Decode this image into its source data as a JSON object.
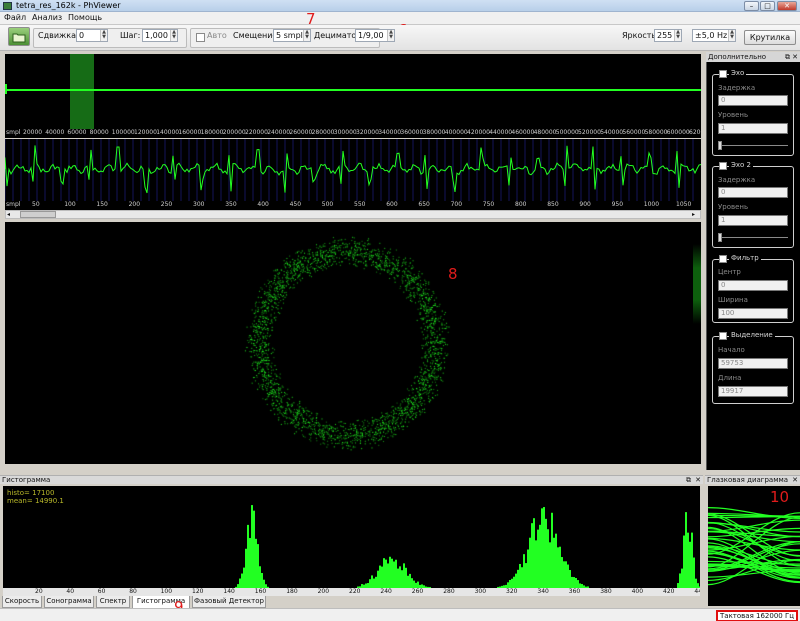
{
  "window": {
    "title": "tetra_res_162k - PhViewer"
  },
  "window_controls": {
    "minimize": "–",
    "maximize": "□",
    "close": "✕"
  },
  "menu": {
    "file": "Файл",
    "analysis": "Анализ",
    "help": "Помощь"
  },
  "annotations": {
    "a7": "7",
    "a6": "6",
    "a8": "8",
    "a9": "9",
    "a10": "10"
  },
  "toolbar": {
    "shift_label": "Сдвижка:",
    "shift_value": "0",
    "step_label": "Шаг:",
    "step_value": "1,000",
    "auto_label": "Авто",
    "offset_label": "Смещение:",
    "offset_value": "5 smpl",
    "decimator_label": "Дециматор:",
    "decimator_value": "1/9,00",
    "brightness_label": "Яркость:",
    "brightness_value": "255",
    "freq_value": "±5,0 Hz",
    "steepness_button": "Крутилка"
  },
  "overview_axis": {
    "unit": "smpl",
    "ticks": [
      "20000",
      "40000",
      "60000",
      "80000",
      "100000",
      "120000",
      "140000",
      "160000",
      "180000",
      "200000",
      "220000",
      "240000",
      "260000",
      "280000",
      "300000",
      "320000",
      "340000",
      "360000",
      "380000",
      "400000",
      "420000",
      "440000",
      "460000",
      "480000",
      "500000",
      "520000",
      "540000",
      "560000",
      "580000",
      "600000",
      "620000"
    ]
  },
  "wave_axis": {
    "unit": "smpl",
    "ticks": [
      "50",
      "100",
      "150",
      "200",
      "250",
      "300",
      "350",
      "400",
      "450",
      "500",
      "550",
      "600",
      "650",
      "700",
      "750",
      "800",
      "850",
      "900",
      "950",
      "1000",
      "1050"
    ]
  },
  "side_panel": {
    "title": "Дополнительно",
    "echo": {
      "title": "Эхо",
      "delay_label": "Задержка",
      "delay_value": "0",
      "level_label": "Уровень",
      "level_value": "1"
    },
    "echo2": {
      "title": "Эхо 2",
      "delay_label": "Задержка",
      "delay_value": "0",
      "level_label": "Уровень",
      "level_value": "1"
    },
    "filter": {
      "title": "Фильтр",
      "center_label": "Центр",
      "center_value": "0",
      "width_label": "Ширина",
      "width_value": "100"
    },
    "selection": {
      "title": "Выделение",
      "start_label": "Начало",
      "start_value": "59753",
      "length_label": "Длина",
      "length_value": "19917"
    }
  },
  "histogram": {
    "title": "Гистограмма",
    "info_line1": "histo= 17100",
    "info_line2": "mean= 14990.1",
    "ticks": [
      "20",
      "40",
      "60",
      "80",
      "100",
      "120",
      "140",
      "160",
      "180",
      "200",
      "220",
      "240",
      "260",
      "280",
      "300",
      "320",
      "340",
      "360",
      "380",
      "400",
      "420",
      "440"
    ]
  },
  "eye_diagram": {
    "title": "Глазковая диаграмма"
  },
  "tabs": [
    "Скорость",
    "Сонограмма",
    "Спектр",
    "Гистограмма",
    "Фазовый Детектор"
  ],
  "active_tab": "Гистограмма",
  "status": {
    "clock": "Тактовая 162000 Гц"
  },
  "colors": {
    "signal": "#22ff22",
    "annotation": "#e01b1b"
  }
}
